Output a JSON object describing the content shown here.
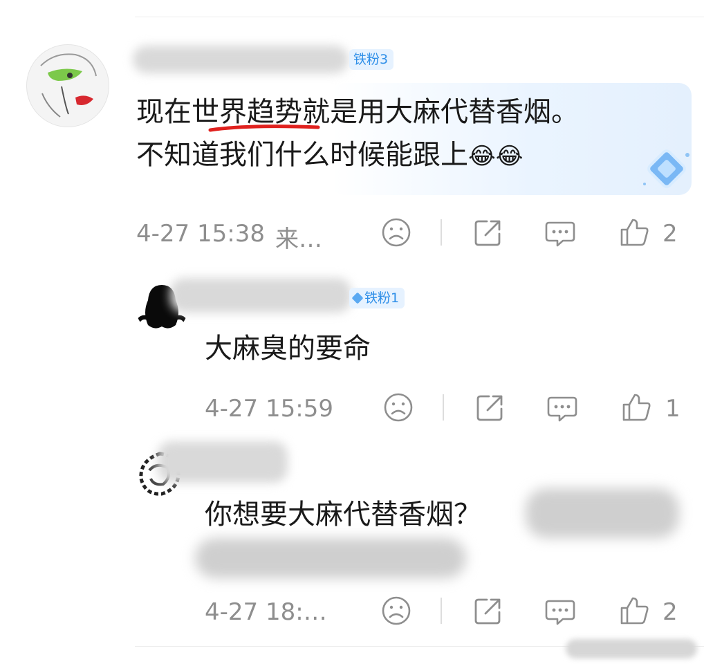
{
  "comments": [
    {
      "badge": "铁粉3",
      "text_line1": "现在世界趋势就是用大麻代替香烟。",
      "text_line2": "不知道我们什么时候能跟上",
      "emoji": "😂😂",
      "time": "4-27 15:38",
      "source": "来…",
      "likes": "2"
    },
    {
      "badge": "铁粉1",
      "text_line1": "大麻臭的要命",
      "time": "4-27 15:59",
      "likes": "1"
    },
    {
      "text_line1": "你想要大麻代替香烟？",
      "time": "4-27 18:…",
      "likes": "2"
    }
  ],
  "icons": {
    "dislike": "sad-face-icon",
    "share": "share-icon",
    "reply": "comment-icon",
    "like": "thumbs-up-icon"
  },
  "colors": {
    "badge_text": "#2f8fe8",
    "badge_bg": "#e6f2ff",
    "meta": "#8e8e8e",
    "underline": "#e0211e"
  }
}
